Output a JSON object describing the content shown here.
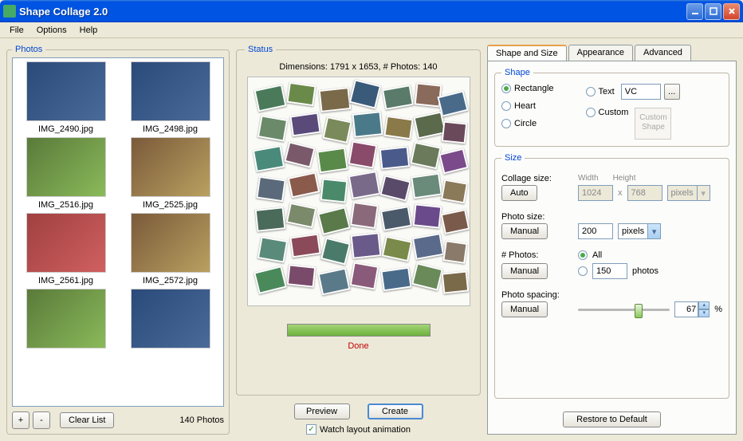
{
  "window": {
    "title": "Shape Collage 2.0"
  },
  "menu": {
    "file": "File",
    "options": "Options",
    "help": "Help"
  },
  "photos": {
    "legend": "Photos",
    "thumbs": [
      {
        "label": "IMG_2490.jpg"
      },
      {
        "label": "IMG_2498.jpg"
      },
      {
        "label": "IMG_2516.jpg"
      },
      {
        "label": "IMG_2525.jpg"
      },
      {
        "label": "IMG_2561.jpg"
      },
      {
        "label": "IMG_2572.jpg"
      }
    ],
    "add": "+",
    "remove": "-",
    "clear": "Clear List",
    "count": "140 Photos"
  },
  "status": {
    "legend": "Status",
    "dimensions": "Dimensions: 1791 x 1653, # Photos: 140",
    "done": "Done",
    "preview": "Preview",
    "create": "Create",
    "watch": "Watch layout animation"
  },
  "tabs": {
    "shape": "Shape and Size",
    "appearance": "Appearance",
    "advanced": "Advanced"
  },
  "shape": {
    "legend": "Shape",
    "rectangle": "Rectangle",
    "heart": "Heart",
    "circle": "Circle",
    "text": "Text",
    "text_value": "VC",
    "dots": "...",
    "custom": "Custom",
    "custom_box": "Custom Shape"
  },
  "size": {
    "legend": "Size",
    "collage_label": "Collage size:",
    "auto": "Auto",
    "width_label": "Width",
    "width": "1024",
    "x": "x",
    "height_label": "Height",
    "height": "768",
    "pixels": "pixels",
    "photo_label": "Photo size:",
    "manual": "Manual",
    "photo_value": "200",
    "numphotos_label": "# Photos:",
    "all": "All",
    "numphotos_value": "150",
    "photos_unit": "photos",
    "spacing_label": "Photo spacing:",
    "spacing_value": "67",
    "percent": "%"
  },
  "restore": "Restore to Default"
}
